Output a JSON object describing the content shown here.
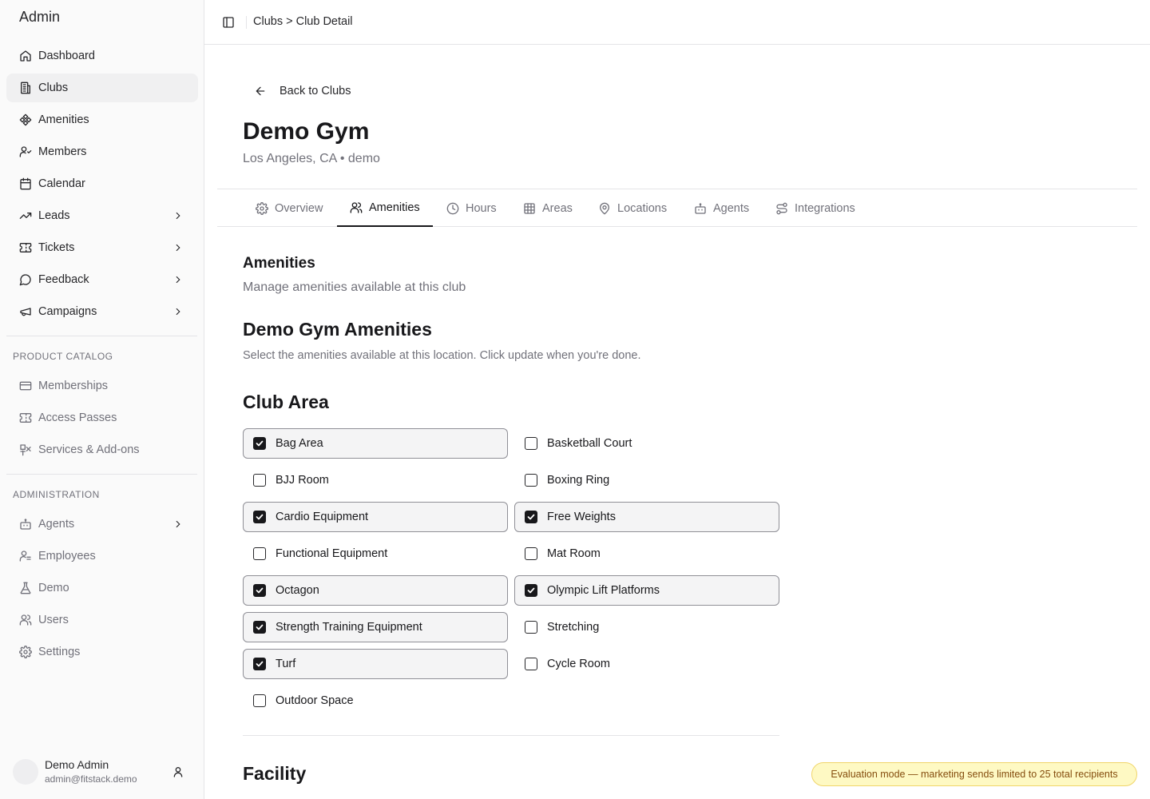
{
  "app": {
    "title": "Admin"
  },
  "sidebar": {
    "main_items": [
      {
        "label": "Dashboard",
        "icon": "home-icon"
      },
      {
        "label": "Clubs",
        "icon": "building-icon",
        "active": true
      },
      {
        "label": "Amenities",
        "icon": "amenities-icon"
      },
      {
        "label": "Members",
        "icon": "members-icon"
      },
      {
        "label": "Calendar",
        "icon": "calendar-icon"
      },
      {
        "label": "Leads",
        "icon": "trending-up-icon",
        "expandable": true
      },
      {
        "label": "Tickets",
        "icon": "ticket-icon",
        "expandable": true
      },
      {
        "label": "Feedback",
        "icon": "message-icon",
        "expandable": true
      },
      {
        "label": "Campaigns",
        "icon": "megaphone-icon",
        "expandable": true
      }
    ],
    "product_catalog": {
      "label": "PRODUCT CATALOG",
      "items": [
        {
          "label": "Memberships",
          "icon": "credit-card-icon"
        },
        {
          "label": "Access Passes",
          "icon": "ticket-icon"
        },
        {
          "label": "Services & Add-ons",
          "icon": "services-icon"
        }
      ]
    },
    "administration": {
      "label": "ADMINISTRATION",
      "items": [
        {
          "label": "Agents",
          "icon": "bot-icon",
          "expandable": true
        },
        {
          "label": "Employees",
          "icon": "employees-icon"
        },
        {
          "label": "Demo",
          "icon": "flask-icon"
        },
        {
          "label": "Users",
          "icon": "users-icon"
        },
        {
          "label": "Settings",
          "icon": "gear-icon"
        }
      ]
    },
    "user": {
      "name": "Demo Admin",
      "email": "admin@fitstack.demo"
    }
  },
  "header": {
    "breadcrumb": "Clubs > Club Detail"
  },
  "page": {
    "back_label": "Back to Clubs",
    "title": "Demo Gym",
    "subtitle": "Los Angeles, CA • demo"
  },
  "tabs": [
    {
      "label": "Overview",
      "icon": "gear-icon"
    },
    {
      "label": "Amenities",
      "icon": "users-icon",
      "active": true
    },
    {
      "label": "Hours",
      "icon": "clock-icon"
    },
    {
      "label": "Areas",
      "icon": "grid-icon"
    },
    {
      "label": "Locations",
      "icon": "map-pin-icon"
    },
    {
      "label": "Agents",
      "icon": "bot-icon"
    },
    {
      "label": "Integrations",
      "icon": "integrations-icon"
    }
  ],
  "amenities_section": {
    "title": "Amenities",
    "description": "Manage amenities available at this club",
    "heading": "Demo Gym Amenities",
    "instructions": "Select the amenities available at this location. Click update when you're done.",
    "club_area": {
      "title": "Club Area",
      "items": [
        {
          "label": "Bag Area",
          "checked": true
        },
        {
          "label": "Basketball Court",
          "checked": false
        },
        {
          "label": "BJJ Room",
          "checked": false
        },
        {
          "label": "Boxing Ring",
          "checked": false
        },
        {
          "label": "Cardio Equipment",
          "checked": true
        },
        {
          "label": "Free Weights",
          "checked": true
        },
        {
          "label": "Functional Equipment",
          "checked": false
        },
        {
          "label": "Mat Room",
          "checked": false
        },
        {
          "label": "Octagon",
          "checked": true
        },
        {
          "label": "Olympic Lift Platforms",
          "checked": true
        },
        {
          "label": "Strength Training Equipment",
          "checked": true
        },
        {
          "label": "Stretching",
          "checked": false
        },
        {
          "label": "Turf",
          "checked": true
        },
        {
          "label": "Cycle Room",
          "checked": false
        },
        {
          "label": "Outdoor Space",
          "checked": false
        }
      ]
    },
    "facility": {
      "title": "Facility"
    }
  },
  "banner": {
    "text": "Evaluation mode — marketing sends limited to 25 total recipients"
  },
  "colors": {
    "accent": "#18181b",
    "banner_bg": "#fef9c3",
    "banner_text": "#854d0e"
  }
}
